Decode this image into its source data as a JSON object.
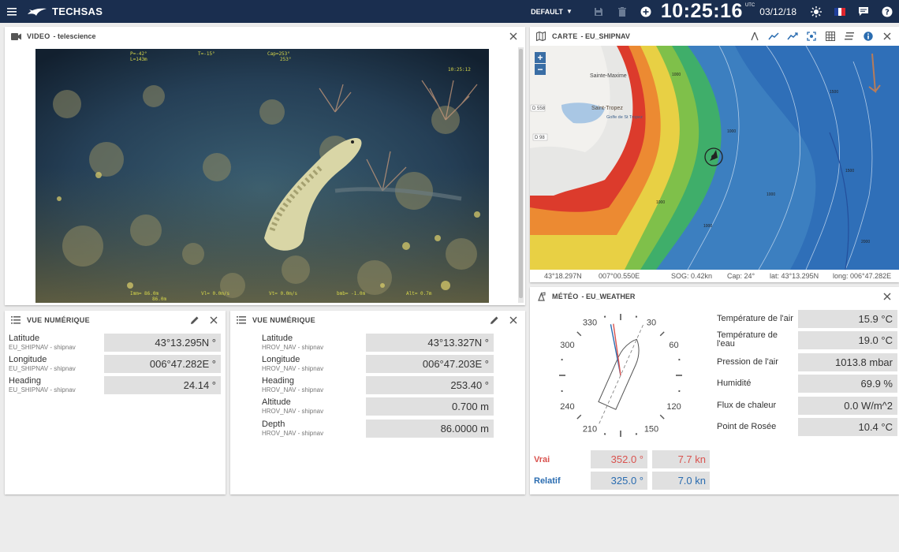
{
  "app": {
    "brand": "TECHSAS"
  },
  "topbar": {
    "profile": "DEFAULT",
    "clock": "10:25:16",
    "utc": "UTC",
    "date": "03/12/18",
    "flag_colors": [
      "#1f3f9c",
      "#ffffff",
      "#e0262e"
    ]
  },
  "video": {
    "title": "VIDEO",
    "subtitle": "- telescience",
    "osd": {
      "p": "P=-42°",
      "t": "T=-15°",
      "cap": "Cap=253°",
      "l": "L=143m",
      "cap2": "253°",
      "time": "10:25:12",
      "imm": "Imm=  86.0m",
      "imm2": "86.0m",
      "vl": "Vl= 0.0m/s",
      "vt": "Vt= 0.0m/s",
      "bmb": "bmb=  -1.0m",
      "alt": "Alt=  0.7m"
    }
  },
  "numeric1": {
    "title": "VUE NUMÉRIQUE",
    "rows": [
      {
        "label": "Latitude",
        "source": "EU_SHIPNAV - shipnav",
        "value": "43°13.295N °"
      },
      {
        "label": "Longitude",
        "source": "EU_SHIPNAV - shipnav",
        "value": "006°47.282E °"
      },
      {
        "label": "Heading",
        "source": "EU_SHIPNAV - shipnav",
        "value": "24.14 °"
      }
    ]
  },
  "numeric2": {
    "title": "VUE NUMÉRIQUE",
    "rows": [
      {
        "label": "Latitude",
        "source": "HROV_NAV - shipnav",
        "value": "43°13.327N °"
      },
      {
        "label": "Longitude",
        "source": "HROV_NAV - shipnav",
        "value": "006°47.203E °"
      },
      {
        "label": "Heading",
        "source": "HROV_NAV - shipnav",
        "value": "253.40 °"
      },
      {
        "label": "Altitude",
        "source": "HROV_NAV - shipnav",
        "value": "0.700 m"
      },
      {
        "label": "Depth",
        "source": "HROV_NAV - shipnav",
        "value": "86.0000 m"
      }
    ]
  },
  "map": {
    "title": "CARTE",
    "subtitle": "- EU_SHIPNAV",
    "zoom_in": "+",
    "zoom_out": "−",
    "places": {
      "sainte_maxime": "Sainte-Maxime",
      "saint_tropez": "Saint-Tropez",
      "golfe": "Golfe de St Tropez",
      "d558": "D 558",
      "d98": "D 98"
    },
    "contour_labels": [
      "1000",
      "1000",
      "1500",
      "1500",
      "1000",
      "1000",
      "1000",
      "2000"
    ],
    "status": {
      "pos1": "43°18.297N",
      "pos2": "007°00.550E",
      "sog": "SOG: 0.42kn",
      "cap": "Cap: 24°",
      "lat": "lat: 43°13.295N",
      "long": "long: 006°47.282E"
    }
  },
  "weather": {
    "title": "MÉTÉO",
    "subtitle": "- EU_WEATHER",
    "compass_labels": [
      {
        "deg": 330,
        "text": "330"
      },
      {
        "deg": 30,
        "text": "30"
      },
      {
        "deg": 300,
        "text": "300"
      },
      {
        "deg": 60,
        "text": "60"
      },
      {
        "deg": 240,
        "text": "240"
      },
      {
        "deg": 120,
        "text": "120"
      },
      {
        "deg": 210,
        "text": "210"
      },
      {
        "deg": 150,
        "text": "150"
      }
    ],
    "ship_heading_deg": 24,
    "true_wind_deg": 352,
    "relative_wind_deg": 325,
    "wind_colors": {
      "vrai": "#d9534f",
      "relatif": "#2a6cb0"
    },
    "vrai": {
      "label": "Vrai",
      "dir": "352.0 °",
      "speed": "7.7 kn"
    },
    "relatif": {
      "label": "Relatif",
      "dir": "325.0 °",
      "speed": "7.0 kn"
    },
    "rows": [
      {
        "label": "Température de l'air",
        "value": "15.9 °C"
      },
      {
        "label": "Température de l'eau",
        "value": "19.0 °C"
      },
      {
        "label": "Pression de l'air",
        "value": "1013.8 mbar"
      },
      {
        "label": "Humidité",
        "value": "69.9 %"
      },
      {
        "label": "Flux de chaleur",
        "value": "0.0 W/m^2"
      },
      {
        "label": "Point de Rosée",
        "value": "10.4 °C"
      }
    ]
  }
}
